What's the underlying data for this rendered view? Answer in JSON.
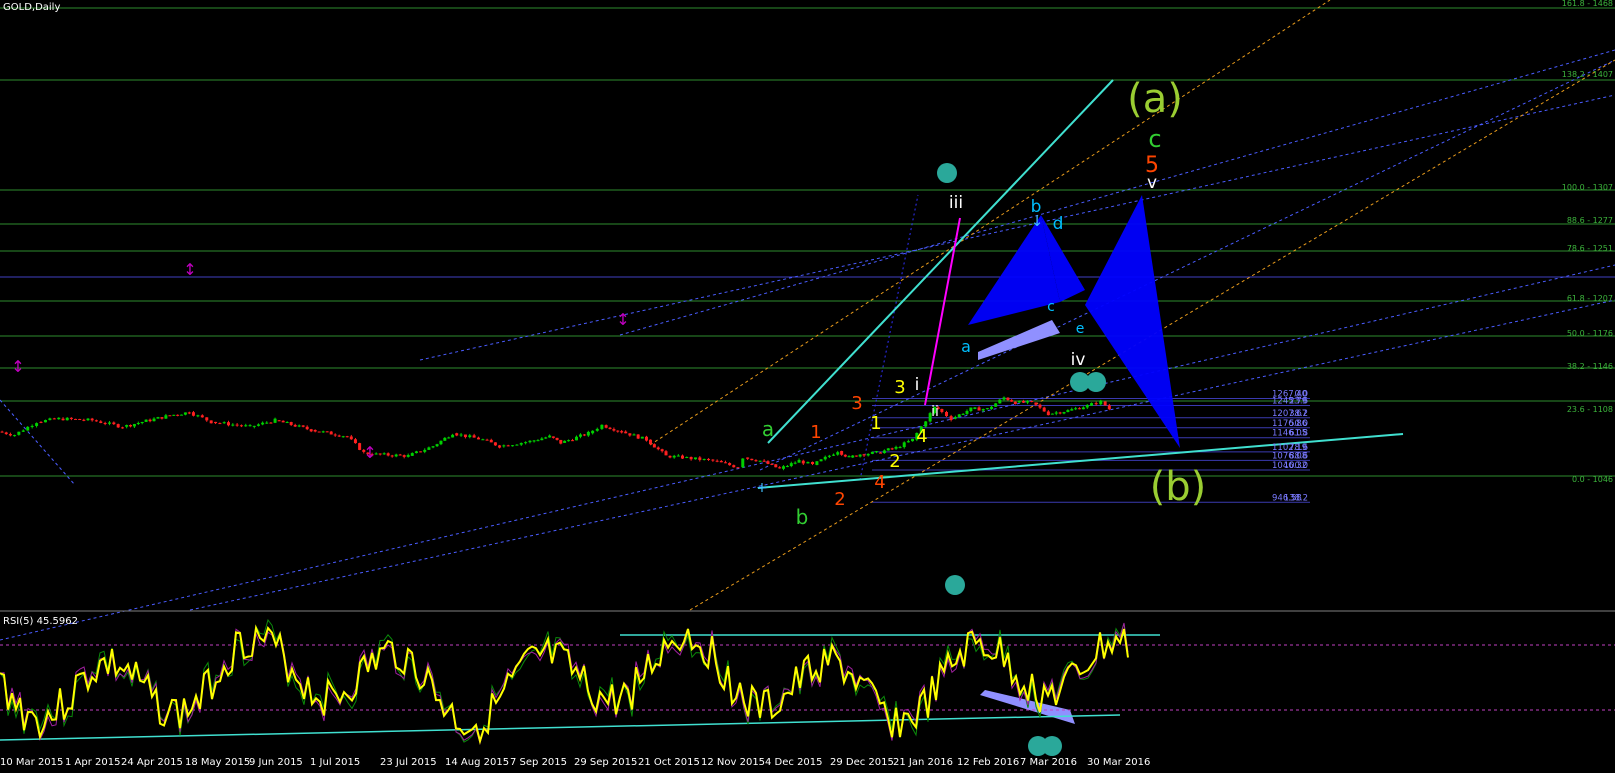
{
  "window": {
    "title": "GOLD,Daily"
  },
  "indicator": {
    "label": "RSI(5) 45.5962"
  },
  "chart_data": {
    "type": "candlestick",
    "symbol": "GOLD",
    "timeframe": "Daily",
    "x_tick_labels": [
      "10 Mar 2015",
      "1 Apr 2015",
      "24 Apr 2015",
      "18 May 2015",
      "9 Jun 2015",
      "1 Jul 2015",
      "23 Jul 2015",
      "14 Aug 2015",
      "7 Sep 2015",
      "29 Sep 2015",
      "21 Oct 2015",
      "12 Nov 2015",
      "4 Dec 2015",
      "29 Dec 2015",
      "21 Jan 2016",
      "12 Feb 2016",
      "7 Mar 2016",
      "30 Mar 2016"
    ],
    "price_path": [
      [
        "10 Mar 2015",
        1165
      ],
      [
        "16 Mar 2015",
        1155
      ],
      [
        "24 Mar 2015",
        1195
      ],
      [
        "1 Apr 2015",
        1205
      ],
      [
        "13 Apr 2015",
        1200
      ],
      [
        "24 Apr 2015",
        1180
      ],
      [
        "1 May 2015",
        1195
      ],
      [
        "11 May 2015",
        1215
      ],
      [
        "18 May 2015",
        1225
      ],
      [
        "26 May 2015",
        1195
      ],
      [
        "9 Jun 2015",
        1180
      ],
      [
        "18 Jun 2015",
        1200
      ],
      [
        "1 Jul 2015",
        1170
      ],
      [
        "14 Jul 2015",
        1150
      ],
      [
        "20 Jul 2015",
        1100
      ],
      [
        "23 Jul 2015",
        1095
      ],
      [
        "5 Aug 2015",
        1090
      ],
      [
        "14 Aug 2015",
        1120
      ],
      [
        "21 Aug 2015",
        1160
      ],
      [
        "1 Sep 2015",
        1140
      ],
      [
        "7 Sep 2015",
        1120
      ],
      [
        "18 Sep 2015",
        1135
      ],
      [
        "25 Sep 2015",
        1150
      ],
      [
        "29 Sep 2015",
        1130
      ],
      [
        "9 Oct 2015",
        1160
      ],
      [
        "14 Oct 2015",
        1185
      ],
      [
        "21 Oct 2015",
        1165
      ],
      [
        "30 Oct 2015",
        1140
      ],
      [
        "6 Nov 2015",
        1090
      ],
      [
        "12 Nov 2015",
        1085
      ],
      [
        "23 Nov 2015",
        1075
      ],
      [
        "2 Dec 2015",
        1055
      ],
      [
        "4 Dec 2015",
        1085
      ],
      [
        "10 Dec 2015",
        1075
      ],
      [
        "17 Dec 2015",
        1050
      ],
      [
        "24 Dec 2015",
        1075
      ],
      [
        "29 Dec 2015",
        1062
      ],
      [
        "7 Jan 2016",
        1105
      ],
      [
        "11 Jan 2016",
        1085
      ],
      [
        "15 Jan 2016",
        1095
      ],
      [
        "21 Jan 2016",
        1100
      ],
      [
        "28 Jan 2016",
        1115
      ],
      [
        "3 Feb 2016",
        1140
      ],
      [
        "11 Feb 2016",
        1240
      ],
      [
        "12 Feb 2016",
        1235
      ],
      [
        "17 Feb 2016",
        1205
      ],
      [
        "24 Feb 2016",
        1235
      ],
      [
        "1 Mar 2016",
        1235
      ],
      [
        "7 Mar 2016",
        1270
      ],
      [
        "11 Mar 2016",
        1255
      ],
      [
        "17 Mar 2016",
        1255
      ],
      [
        "23 Mar 2016",
        1220
      ],
      [
        "30 Mar 2016",
        1230
      ],
      [
        "6 Apr 2016",
        1245
      ],
      [
        "11 Apr 2016",
        1258
      ],
      [
        "14 Apr 2016",
        1235
      ]
    ],
    "fib_levels_left": [
      {
        "ratio": "0.0",
        "price": "1267.40"
      },
      {
        "ratio": "23.6",
        "price": "1245.79"
      },
      {
        "ratio": "38.2",
        "price": "1207.67"
      },
      {
        "ratio": "50.0",
        "price": "1176.86"
      },
      {
        "ratio": "61.8",
        "price": "1146.05"
      },
      {
        "ratio": "78.6",
        "price": "1102.19"
      },
      {
        "ratio": "88.6",
        "price": "1076.08"
      },
      {
        "ratio": "100.0",
        "price": "1046.32"
      },
      {
        "ratio": "138.2",
        "price": "946.58"
      }
    ],
    "fib_levels_right": [
      "161.8 - 1468",
      "138.2 - 1407",
      "100.0 - 1307",
      "88.6 - 1277",
      "78.6 - 1251",
      "61.8 - 1207",
      "50.0 - 1176",
      "38.2 - 1146",
      "23.6 - 1108",
      "0.0 - 1046"
    ],
    "wave_labels": [
      {
        "text": "(a)",
        "color": "#9acd32"
      },
      {
        "text": "(b)",
        "color": "#9acd32"
      },
      {
        "text": "c",
        "color": "#32cd32"
      },
      {
        "text": "5",
        "color": "#ff4500"
      },
      {
        "text": "v",
        "color": "#ffffff"
      },
      {
        "text": "iii",
        "color": "#ffffff"
      },
      {
        "text": "b",
        "color": "#00bfff"
      },
      {
        "text": "d",
        "color": "#00bfff"
      },
      {
        "text": "c",
        "color": "#00bfff"
      },
      {
        "text": "e",
        "color": "#00bfff"
      },
      {
        "text": "a",
        "color": "#00bfff"
      },
      {
        "text": "iv",
        "color": "#ffffff"
      },
      {
        "text": "i",
        "color": "#ffffff"
      },
      {
        "text": "ii",
        "color": "#ffffff"
      },
      {
        "text": "a",
        "color": "#32cd32"
      },
      {
        "text": "b",
        "color": "#32cd32"
      },
      {
        "text": "1",
        "color": "#ff4500"
      },
      {
        "text": "2",
        "color": "#ff4500"
      },
      {
        "text": "3",
        "color": "#ff4500"
      },
      {
        "text": "4",
        "color": "#ff4500"
      },
      {
        "text": "3",
        "color": "#ffff00"
      },
      {
        "text": "1",
        "color": "#ffff00"
      },
      {
        "text": "2",
        "color": "#ffff00"
      },
      {
        "text": "4",
        "color": "#ffff00"
      }
    ],
    "colors": {
      "background": "#000000",
      "bull": "#00d000",
      "bear": "#ff2020",
      "rsi": "#ffff00",
      "channel": "#40e0d0",
      "pattern": "#0000ff",
      "fib_grid": "#2e8b2e",
      "fib_grid_blue": "#3a3ab0"
    }
  }
}
